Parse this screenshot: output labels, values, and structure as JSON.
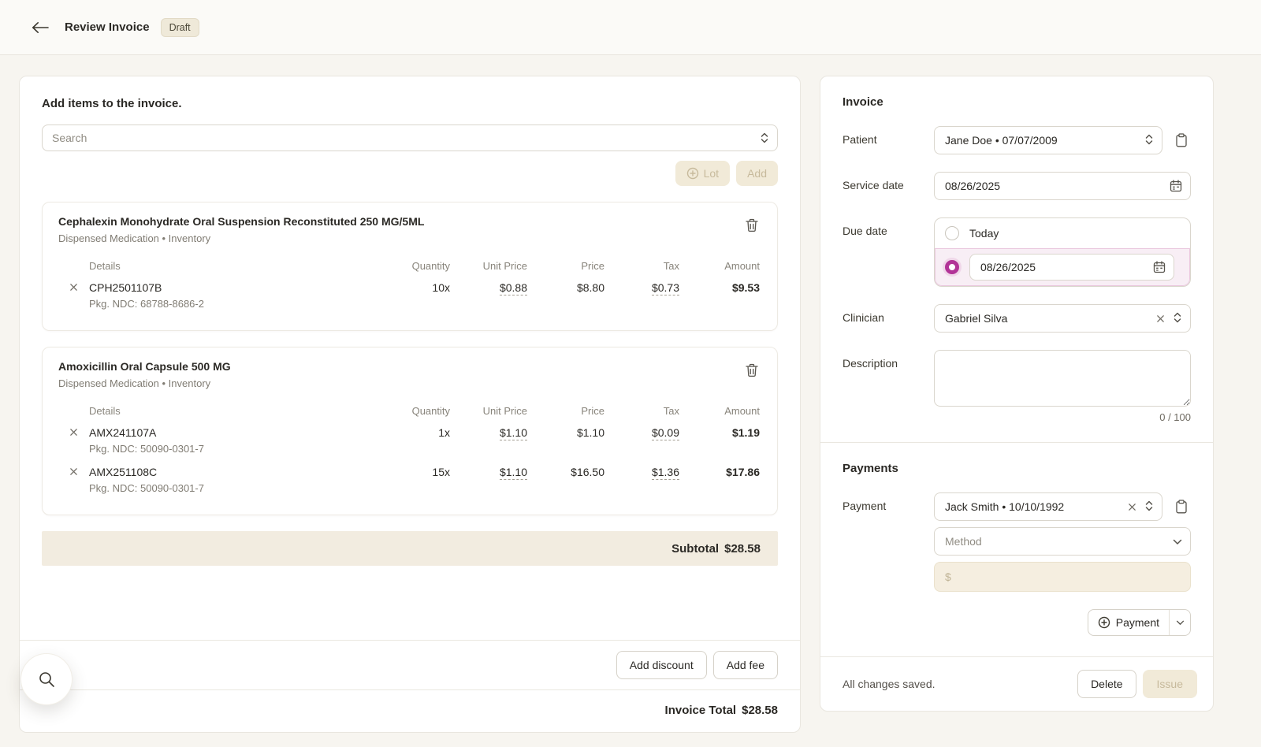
{
  "colors": {
    "accent_magenta": "#b23397",
    "selected_row_pink": "#f8eef5",
    "beige_highlight": "#f2ece0",
    "disabled_button_bg": "#f1ead8",
    "disabled_button_text": "#c7ba9c"
  },
  "icons": {
    "arrow-left-icon": "←",
    "chevron-up-down-icon": "⇕",
    "chevron-down-icon": "⌄",
    "plus-circle-icon": "⊕",
    "trash-icon": "🗑",
    "clipboard-icon": "📋",
    "calendar-icon": "📅",
    "close-icon": "✕",
    "search-icon": "🔍",
    "radio-checked-icon": "◉",
    "radio-unchecked-icon": "○"
  },
  "header": {
    "title": "Review Invoice",
    "status_badge": "Draft"
  },
  "items_panel": {
    "heading": "Add items to the invoice.",
    "search_placeholder": "Search",
    "lot_button_label": "Lot",
    "add_button_label": "Add",
    "table_headers": [
      "Details",
      "Quantity",
      "Unit Price",
      "Price",
      "Tax",
      "Amount"
    ],
    "items": [
      {
        "name": "Cephalexin Monohydrate Oral Suspension Reconstituted 250 MG/5ML",
        "subtitle": "Dispensed Medication • Inventory",
        "rows": [
          {
            "lot": "CPH2501107B",
            "ndc": "Pkg. NDC: 68788-8686-2",
            "quantity": "10x",
            "unit_price": "$0.88",
            "price": "$8.80",
            "tax": "$0.73",
            "amount": "$9.53"
          }
        ]
      },
      {
        "name": "Amoxicillin Oral Capsule 500 MG",
        "subtitle": "Dispensed Medication • Inventory",
        "rows": [
          {
            "lot": "AMX241107A",
            "ndc": "Pkg. NDC: 50090-0301-7",
            "quantity": "1x",
            "unit_price": "$1.10",
            "price": "$1.10",
            "tax": "$0.09",
            "amount": "$1.19"
          },
          {
            "lot": "AMX251108C",
            "ndc": "Pkg. NDC: 50090-0301-7",
            "quantity": "15x",
            "unit_price": "$1.10",
            "price": "$16.50",
            "tax": "$1.36",
            "amount": "$17.86"
          }
        ]
      }
    ],
    "subtotal_label": "Subtotal",
    "subtotal_value": "$28.58",
    "add_discount_label": "Add discount",
    "add_fee_label": "Add fee",
    "invoice_total_label": "Invoice Total",
    "invoice_total_value": "$28.58"
  },
  "invoice_panel": {
    "heading": "Invoice",
    "patient_label": "Patient",
    "patient_value": "Jane Doe • 07/07/2009",
    "service_date_label": "Service date",
    "service_date_value": "08/26/2025",
    "due_date_label": "Due date",
    "due_date_today": "Today",
    "due_date_value": "08/26/2025",
    "clinician_label": "Clinician",
    "clinician_value": "Gabriel Silva",
    "description_label": "Description",
    "description_counter": "0 / 100",
    "payments_heading": "Payments",
    "payment_label": "Payment",
    "payment_value": "Jack Smith • 10/10/1992",
    "method_placeholder": "Method",
    "amount_placeholder": "$",
    "add_payment_label": "Payment",
    "footer_status": "All changes saved.",
    "delete_label": "Delete",
    "issue_label": "Issue"
  }
}
